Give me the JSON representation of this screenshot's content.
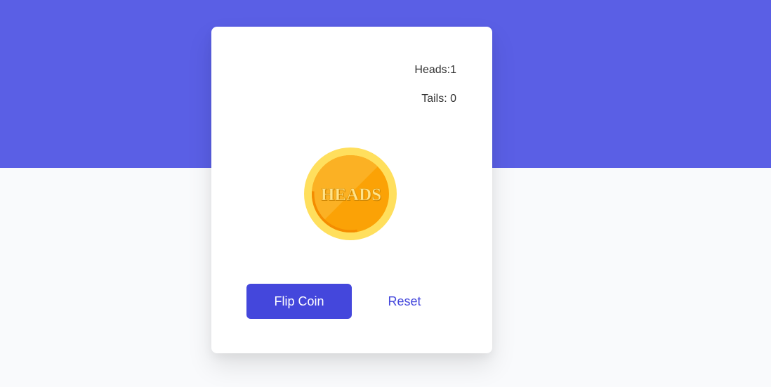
{
  "theme": {
    "header_band_color": "#5a5fe5",
    "page_background": "#f9fafc",
    "button_color": "#4447dc"
  },
  "score": {
    "heads_text": "Heads:1",
    "tails_text": "Tails: 0"
  },
  "coin": {
    "face_label": "HEADS"
  },
  "actions": {
    "flip_label": "Flip Coin",
    "reset_label": "Reset"
  }
}
